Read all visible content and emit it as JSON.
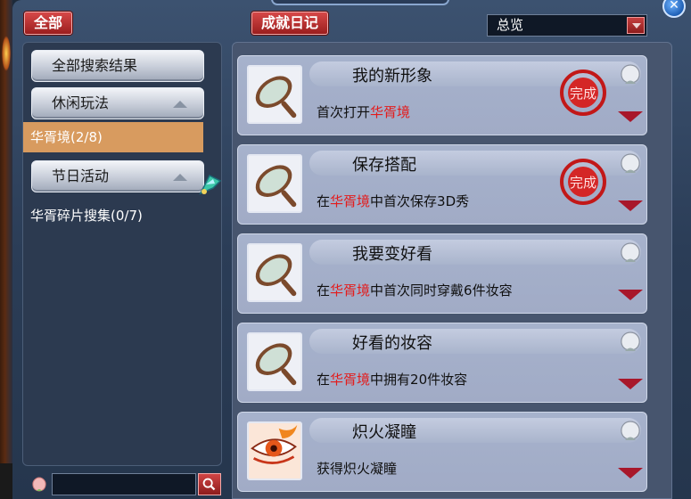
{
  "header": {
    "all_button": "全部",
    "diary_button": "成就日记",
    "overview_select": "总览"
  },
  "sidebar": {
    "categories": [
      {
        "label": "全部搜索结果"
      },
      {
        "label": "休闲玩法"
      },
      {
        "label": "华胥境(2/8)",
        "selected": true
      },
      {
        "label": "节日活动"
      },
      {
        "label": "华胥碎片搜集(0/7)"
      }
    ],
    "search_placeholder": ""
  },
  "achievements": [
    {
      "title": "我的新形象",
      "desc_parts": [
        "首次打开",
        "华胥境",
        ""
      ],
      "completed": true,
      "icon": "mirror-icon"
    },
    {
      "title": "保存搭配",
      "desc_parts": [
        "在",
        "华胥境",
        "中首次保存3D秀"
      ],
      "completed": true,
      "icon": "mirror-icon"
    },
    {
      "title": "我要变好看",
      "desc_parts": [
        "在",
        "华胥境",
        "中首次同时穿戴6件妆容"
      ],
      "completed": false,
      "icon": "mirror-icon"
    },
    {
      "title": "好看的妆容",
      "desc_parts": [
        "在",
        "华胥境",
        "中拥有20件妆容"
      ],
      "completed": false,
      "icon": "mirror-icon"
    },
    {
      "title": "炽火凝瞳",
      "desc_parts": [
        "获得炽火凝瞳",
        "",
        ""
      ],
      "completed": false,
      "icon": "fire-eye-icon"
    }
  ],
  "stamp_text": "完成",
  "colors": {
    "highlight": "#e31b1b",
    "selected_bg": "#d89b5f",
    "red_button": "#b92f2f"
  }
}
